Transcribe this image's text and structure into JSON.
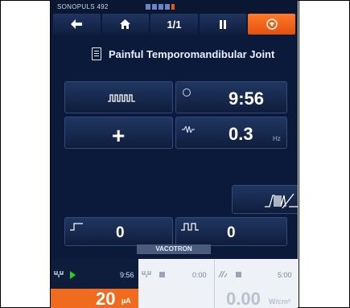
{
  "device": {
    "brand": "SONOPULS 492",
    "nav": {
      "page_indicator": "1/1",
      "buttons": [
        "back",
        "home",
        "pause",
        "stop"
      ]
    },
    "program_title": "Painful Temporomandibular Joint",
    "params": {
      "time": "9:56",
      "frequency": "0.3",
      "frequency_unit": "Hz",
      "left_value": "0",
      "right_value": "0",
      "module_label": "VACOTRON"
    },
    "channels": [
      {
        "time": "9:56",
        "status": "playing",
        "amplitude": "20",
        "amplitude_unit": "µA"
      },
      {
        "time": "0:00",
        "status": "stopped"
      },
      {
        "time": "5:00",
        "status": "stopped",
        "intensity": "0.00",
        "intensity_unit": "W/cm²"
      }
    ],
    "colors": {
      "accent": "#f06b1e",
      "background": "#0b1a3a",
      "play": "#28d21a"
    }
  }
}
